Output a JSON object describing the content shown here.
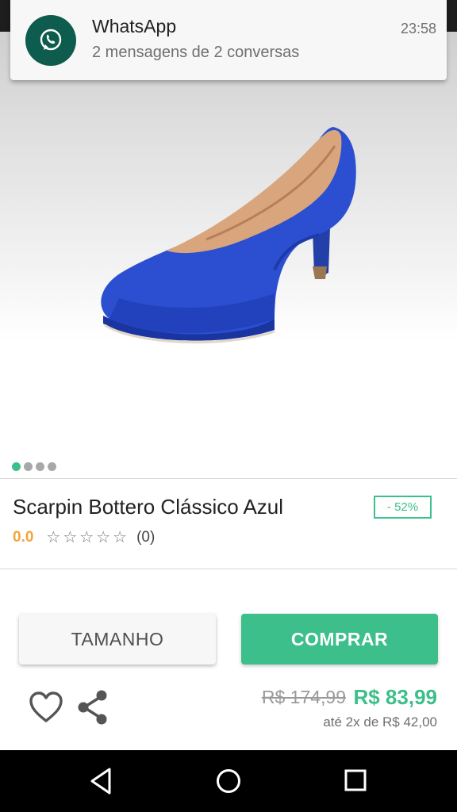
{
  "notification": {
    "app": "WhatsApp",
    "text": "2 mensagens de 2 conversas",
    "time": "23:58",
    "icon": "whatsapp-icon"
  },
  "gallery": {
    "total_images": 4,
    "active_index": 0
  },
  "product": {
    "title": "Scarpin Bottero Clássico Azul",
    "discount": "- 52%",
    "rating_value": "0.0",
    "rating_stars": 0,
    "rating_max": 5,
    "rating_count": "(0)"
  },
  "actions": {
    "size_label": "TAMANHO",
    "buy_label": "COMPRAR"
  },
  "price": {
    "old": "R$ 174,99",
    "new": "R$ 83,99",
    "installments": "até 2x de R$ 42,00"
  },
  "colors": {
    "accent": "#3cbf8a",
    "rating": "#f0a63a",
    "whatsapp": "#0e5c4d"
  }
}
